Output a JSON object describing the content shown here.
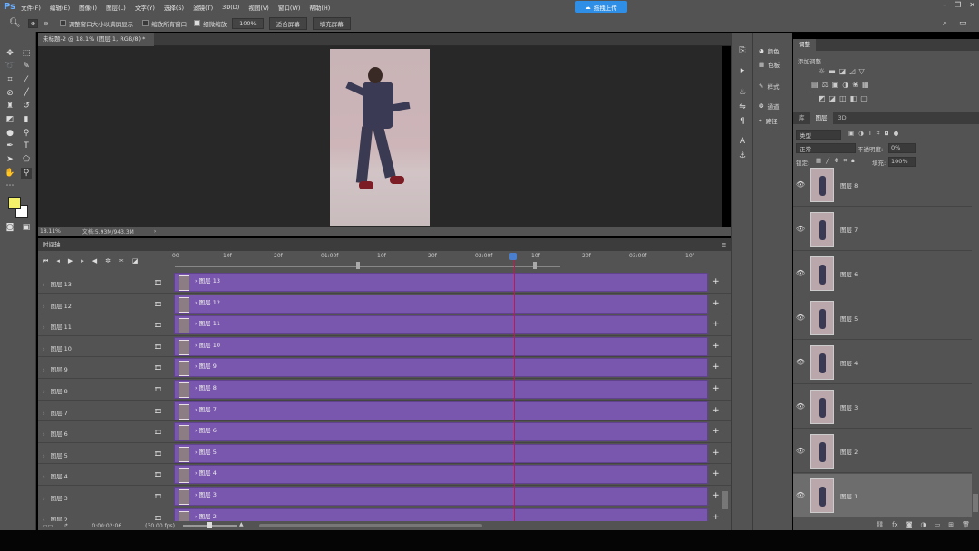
{
  "app": {
    "logo": "Ps",
    "upload_label": "拖拽上传"
  },
  "menu": [
    "文件(F)",
    "编辑(E)",
    "图像(I)",
    "图层(L)",
    "文字(Y)",
    "选择(S)",
    "滤镜(T)",
    "3D(D)",
    "视图(V)",
    "窗口(W)",
    "帮助(H)"
  ],
  "options": {
    "resize_windows": "调整窗口大小以满屏显示",
    "zoom_all": "缩放所有窗口",
    "scrubby_zoom": "细微缩放",
    "zoom_value": "100%",
    "fit_screen": "适合屏幕",
    "fill_screen": "填充屏幕"
  },
  "document": {
    "tab_title": "未标题-2 @ 18.1% (图层 1, RGB/8) *",
    "zoom": "18.11%",
    "doc_size": "文档:5.93M/943.3M"
  },
  "right_strip": {
    "items": [
      "颜色",
      "色板",
      "样式",
      "通道",
      "路径"
    ]
  },
  "adjustments": {
    "tab": "调整",
    "add_label": "添加调整"
  },
  "layers_panel": {
    "tabs": [
      "库",
      "图层",
      "3D"
    ],
    "filter": "类型",
    "blend_mode": "正常",
    "opacity_label": "不透明度:",
    "opacity_value": "0%",
    "lock_label": "锁定:",
    "fill_label": "填充:",
    "fill_value": "100%",
    "layers": [
      "图层 8",
      "图层 7",
      "图层 6",
      "图层 5",
      "图层 4",
      "图层 3",
      "图层 2",
      "图层 1"
    ]
  },
  "timeline": {
    "title": "时间轴",
    "timecode": "0:00:02:06",
    "fps": "(30.00 fps)",
    "ruler": [
      "00",
      "10f",
      "20f",
      "01:00f",
      "10f",
      "20f",
      "02:00f",
      "10f",
      "20f",
      "03:00f",
      "10f"
    ],
    "tracks": [
      "图层 13",
      "图层 12",
      "图层 11",
      "图层 10",
      "图层 9",
      "图层 8",
      "图层 7",
      "图层 6",
      "图层 5",
      "图层 4",
      "图层 3",
      "图层 2"
    ]
  },
  "colors": {
    "accent": "#7a57ae",
    "playhead": "#c01855",
    "foreground": "#f5f06a",
    "background": "#ffffff"
  }
}
